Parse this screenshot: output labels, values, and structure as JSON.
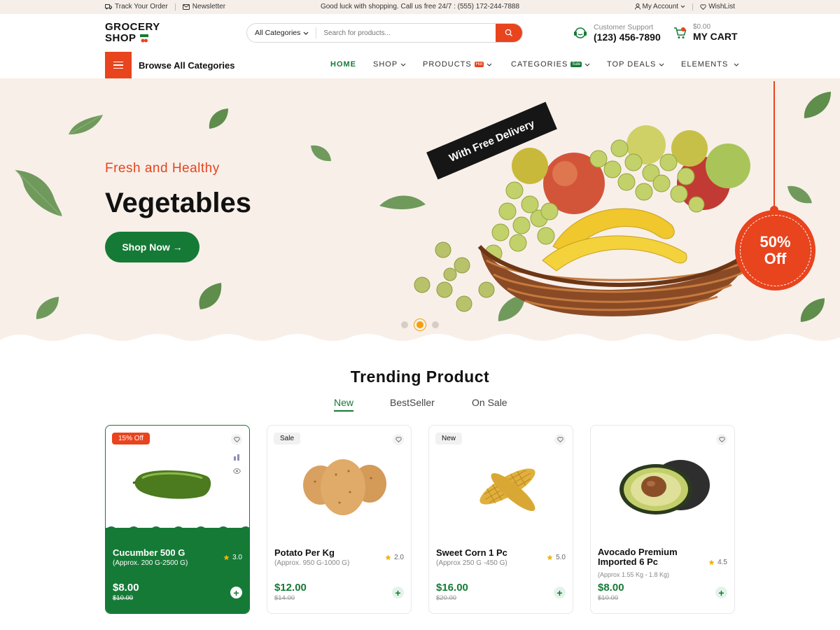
{
  "topbar": {
    "track_order": "Track Your Order",
    "newsletter": "Newsletter",
    "announcement": "Good luck with shopping. Call us free 24/7 : (555) 172-244-7888",
    "my_account": "My Account",
    "wishlist": "WishList"
  },
  "header": {
    "logo_line1": "GROCERY",
    "logo_line2": "SHOP",
    "search_category": "All Categories",
    "search_placeholder": "Search for products...",
    "support_label": "Customer Support",
    "support_phone": "(123) 456-7890",
    "cart_amount": "$0.00",
    "cart_label": "MY CART"
  },
  "nav": {
    "browse_label": "Browse All Categories",
    "items": [
      {
        "label": "HOME"
      },
      {
        "label": "SHOP"
      },
      {
        "label": "PRODUCTS",
        "badge": "Hot"
      },
      {
        "label": "CATEGORIES",
        "badge": "Sale"
      },
      {
        "label": "TOP DEALS"
      },
      {
        "label": "ELEMENTS"
      }
    ]
  },
  "hero": {
    "subtitle": "Fresh and Healthy",
    "title": "Vegetables",
    "cta": "Shop Now →",
    "ribbon": "With Free Delivery",
    "discount_line1": "50%",
    "discount_line2": "Off",
    "slides": 3,
    "active_slide": 2
  },
  "trending": {
    "title": "Trending Product",
    "tabs": [
      "New",
      "BestSeller",
      "On Sale"
    ],
    "active_tab": "New"
  },
  "products": [
    {
      "tag": "15% Off",
      "name": "Cucumber 500 G",
      "sub": "(Approx. 200 G-2500 G)",
      "rating": "3.0",
      "price": "$8.00",
      "old_price": "$10.00"
    },
    {
      "tag": "Sale",
      "name": "Potato Per Kg",
      "sub": "(Approx. 950 G-1000 G)",
      "rating": "2.0",
      "price": "$12.00",
      "old_price": "$14.00"
    },
    {
      "tag": "New",
      "name": "Sweet Corn 1 Pc",
      "sub": "(Approx 250 G -450 G)",
      "rating": "5.0",
      "price": "$16.00",
      "old_price": "$20.00"
    },
    {
      "tag": "",
      "name": "Avocado Premium Imported 6 Pc",
      "sub": "(Approx 1.55 Kg - 1.8 Kg)",
      "rating": "4.5",
      "price": "$8.00",
      "old_price": "$10.00"
    }
  ],
  "colors": {
    "brand_orange": "#e8441e",
    "brand_green": "#157a36",
    "hero_bg": "#f8efe9"
  }
}
